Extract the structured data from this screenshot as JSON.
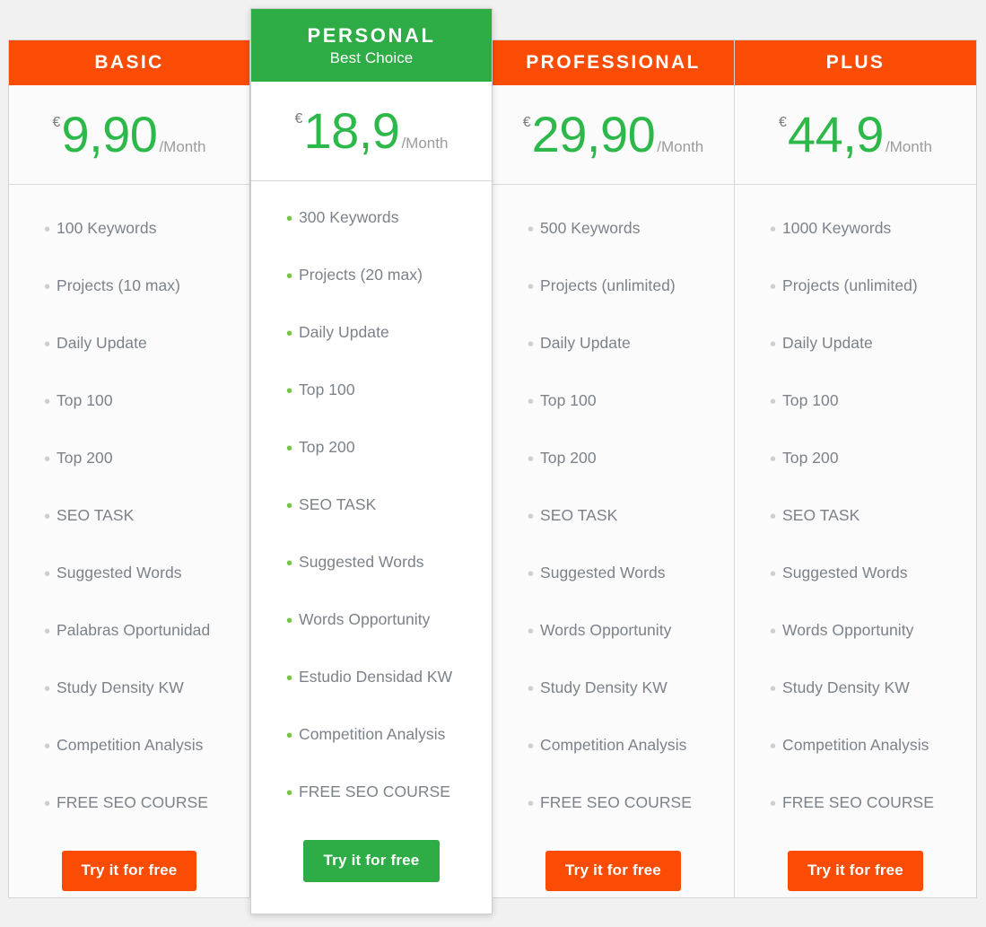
{
  "colors": {
    "page_background": "#f1f1f1",
    "header_orange": "#fb4c05",
    "header_green": "#2eac46",
    "price_green": "#2db84a",
    "feature_text": "#7c8289",
    "bullet_grey": "#cfcfcf",
    "bullet_green": "#76c644",
    "currency_grey": "#7b7b7b",
    "period_grey": "#9b9b9b"
  },
  "plans": [
    {
      "id": "basic",
      "title": "BASIC",
      "subtitle": "",
      "featured": false,
      "currency": "€",
      "amount": "9,90",
      "period": "/Month",
      "features": [
        "100 Keywords",
        "Projects (10 max)",
        "Daily Update",
        "Top 100",
        "Top 200",
        "SEO TASK",
        "Suggested Words",
        "Palabras Oportunidad",
        "Study Density KW",
        "Competition Analysis",
        "FREE SEO COURSE"
      ],
      "cta_label": "Try it for free"
    },
    {
      "id": "personal",
      "title": "PERSONAL",
      "subtitle": "Best Choice",
      "featured": true,
      "currency": "€",
      "amount": "18,9",
      "period": "/Month",
      "features": [
        "300 Keywords",
        "Projects (20 max)",
        "Daily Update",
        "Top 100",
        "Top 200",
        "SEO TASK",
        "Suggested Words",
        "Words Opportunity",
        "Estudio Densidad KW",
        "Competition Analysis",
        "FREE SEO COURSE"
      ],
      "cta_label": "Try it for free"
    },
    {
      "id": "professional",
      "title": "PROFESSIONAL",
      "subtitle": "",
      "featured": false,
      "currency": "€",
      "amount": "29,90",
      "period": "/Month",
      "features": [
        "500 Keywords",
        "Projects (unlimited)",
        "Daily Update",
        "Top 100",
        "Top 200",
        "SEO TASK",
        "Suggested Words",
        "Words Opportunity",
        "Study Density KW",
        "Competition Analysis",
        "FREE SEO COURSE"
      ],
      "cta_label": "Try it for free"
    },
    {
      "id": "plus",
      "title": "PLUS",
      "subtitle": "",
      "featured": false,
      "currency": "€",
      "amount": "44,9",
      "period": "/Month",
      "features": [
        "1000 Keywords",
        "Projects (unlimited)",
        "Daily Update",
        "Top 100",
        "Top 200",
        "SEO TASK",
        "Suggested Words",
        "Words Opportunity",
        "Study Density KW",
        "Competition Analysis",
        "FREE SEO COURSE"
      ],
      "cta_label": "Try it for free"
    }
  ]
}
